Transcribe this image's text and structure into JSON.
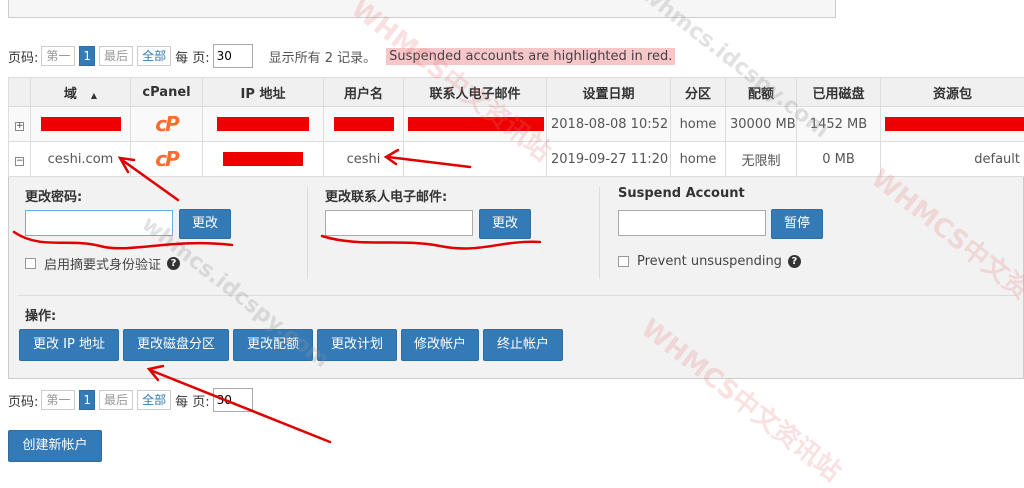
{
  "pager_top": {
    "label": "页码:",
    "first": "第一",
    "current": "1",
    "last": "最后",
    "all": "全部",
    "per_page_label": "每 页:",
    "per_page_value": "30",
    "count_text": "显示所有 2 记录。",
    "suspended_note": "Suspended accounts are highlighted in red."
  },
  "table": {
    "headers": {
      "domain": "域",
      "cpanel": "cPanel",
      "ip": "IP 地址",
      "username": "用户名",
      "email": "联系人电子邮件",
      "date": "设置日期",
      "partition": "分区",
      "quota": "配额",
      "disk_used": "已用磁盘",
      "package": "资源包"
    },
    "rows": [
      {
        "expander": "+",
        "domain": "",
        "username": "",
        "email": "",
        "date": "2018-08-08 10:52",
        "partition": "home",
        "quota": "30000 MB",
        "disk_used": "1452 MB",
        "package": ""
      },
      {
        "expander": "−",
        "domain": "ceshi.com",
        "username": "ceshi",
        "email": "",
        "date": "2019-09-27 11:20",
        "partition": "home",
        "quota": "无限制",
        "disk_used": "0 MB",
        "package": "default"
      }
    ],
    "cpanel_logo": "cP"
  },
  "detail": {
    "change_password_title": "更改密码:",
    "change_password_button": "更改",
    "digest_auth_label": "启用摘要式身份验证",
    "change_email_title": "更改联系人电子邮件:",
    "change_email_button": "更改",
    "suspend_title": "Suspend Account",
    "suspend_button": "暂停",
    "prevent_unsuspend_label": "Prevent unsuspending",
    "actions_title": "操作:",
    "actions": [
      "更改 IP 地址",
      "更改磁盘分区",
      "更改配额",
      "更改计划",
      "修改帐户",
      "终止帐户"
    ],
    "help_icon": "?"
  },
  "pager_bottom": {
    "label": "页码:",
    "first": "第一",
    "current": "1",
    "last": "最后",
    "all": "全部",
    "per_page_label": "每 页:",
    "per_page_value": "30"
  },
  "create_button": "创建新帐户",
  "watermarks": [
    "WHMCS中文资讯站",
    "whmcs.idcspy.com"
  ],
  "colors": {
    "accent": "#337ab7",
    "suspended_note_bg": "#f7c6c9",
    "redaction": "#ee0000",
    "annotation": "#e00000",
    "cpanel_orange": "#ff6c2c"
  }
}
